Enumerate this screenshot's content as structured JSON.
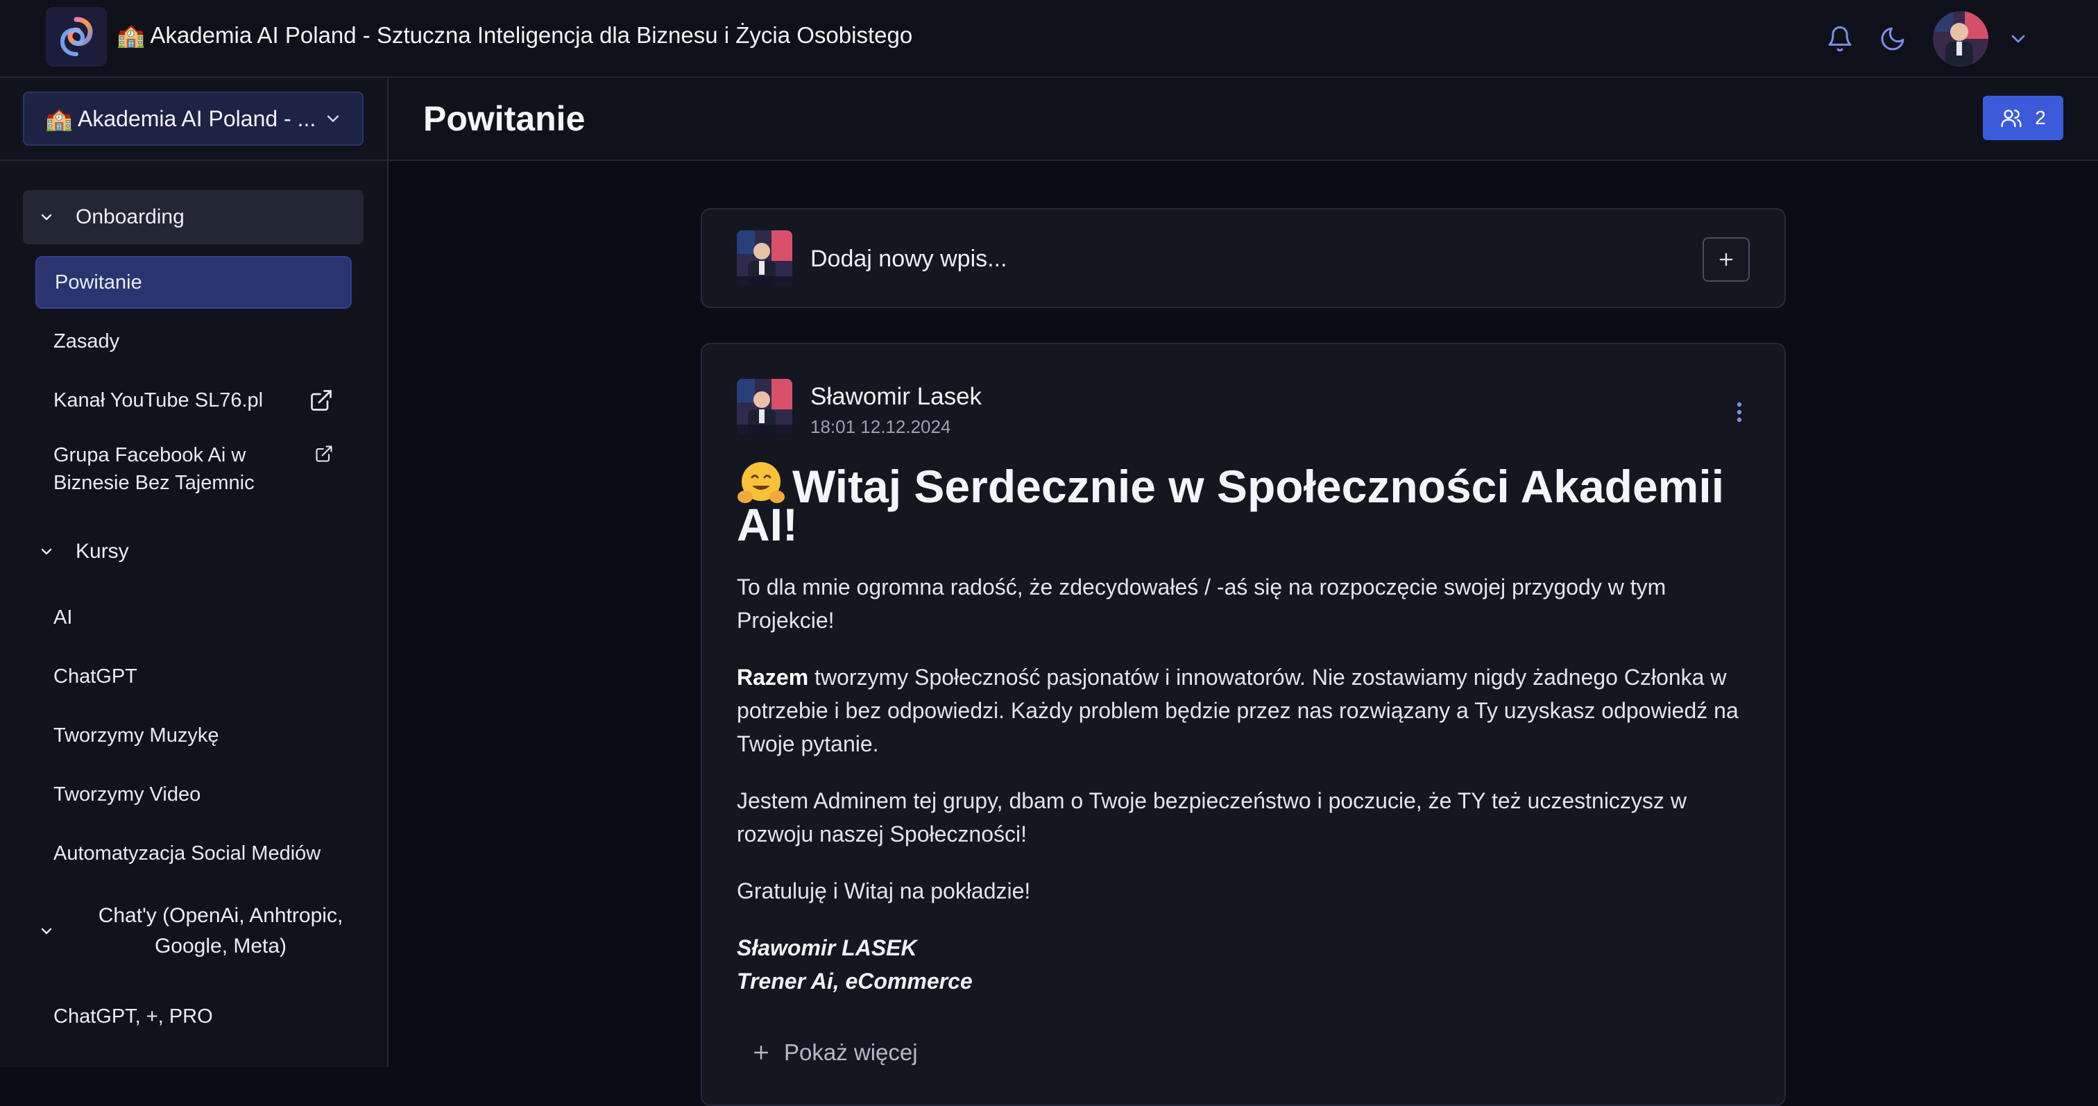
{
  "app": {
    "title": "🏫 Akademia AI Poland - Sztuczna Inteligencja dla Biznesu i Życia Osobistego"
  },
  "topbar": {
    "icons": [
      "bell-icon",
      "moon-icon",
      "avatar",
      "chevron-down-icon"
    ]
  },
  "sidebar": {
    "community_select": "🏫 Akademia AI Poland - ...",
    "sections": [
      {
        "label": "Onboarding",
        "items": [
          {
            "label": "Powitanie",
            "active": true
          },
          {
            "label": "Zasady"
          },
          {
            "label": "Kanał YouTube SL76.pl",
            "external": true
          },
          {
            "label": "Grupa Facebook Ai w Biznesie Bez Tajemnic",
            "external": true
          }
        ]
      },
      {
        "label": "Kursy",
        "items": [
          {
            "label": "AI"
          },
          {
            "label": "ChatGPT"
          },
          {
            "label": "Tworzymy Muzykę"
          },
          {
            "label": "Tworzymy Video"
          },
          {
            "label": "Automatyzacja Social Mediów"
          }
        ]
      },
      {
        "label": "Chat'y (OpenAi, Anhtropic, Google, Meta)",
        "items": [
          {
            "label": "ChatGPT, +, PRO"
          }
        ]
      }
    ]
  },
  "main": {
    "page_title": "Powitanie",
    "members_count": "2",
    "composer": {
      "placeholder": "Dodaj nowy wpis..."
    },
    "post": {
      "author": "Sławomir Lasek",
      "timestamp": "18:01 12.12.2024",
      "heading_emoji": "🤗",
      "heading": "Witaj Serdecznie w Społeczności Akademii AI!",
      "paragraphs": {
        "p1": "To dla mnie ogromna radość, że zdecydowałeś / -aś się na rozpoczęcie swojej przygody w tym Projekcie!",
        "p2_bold": "Razem",
        "p2_rest": " tworzymy Społeczność pasjonatów i innowatorów. Nie zostawiamy nigdy żadnego Członka w potrzebie i bez odpowiedzi. Każdy problem będzie przez nas rozwiązany a Ty uzyskasz odpowiedź na Twoje pytanie.",
        "p3": "Jestem Adminem tej grupy, dbam o Twoje bezpieczeństwo i poczucie, że TY też uczestniczysz w rozwoju naszej Społeczności!",
        "p4": "Gratuluję i Witaj na pokładzie!"
      },
      "signature": {
        "line1": "Sławomir LASEK",
        "line2": "Trener Ai, eCommerce"
      },
      "show_more": "Pokaż więcej"
    }
  },
  "colors": {
    "background": "#0b0c14",
    "accent": "#3b5bdb",
    "active_nav": "#2a3570"
  }
}
